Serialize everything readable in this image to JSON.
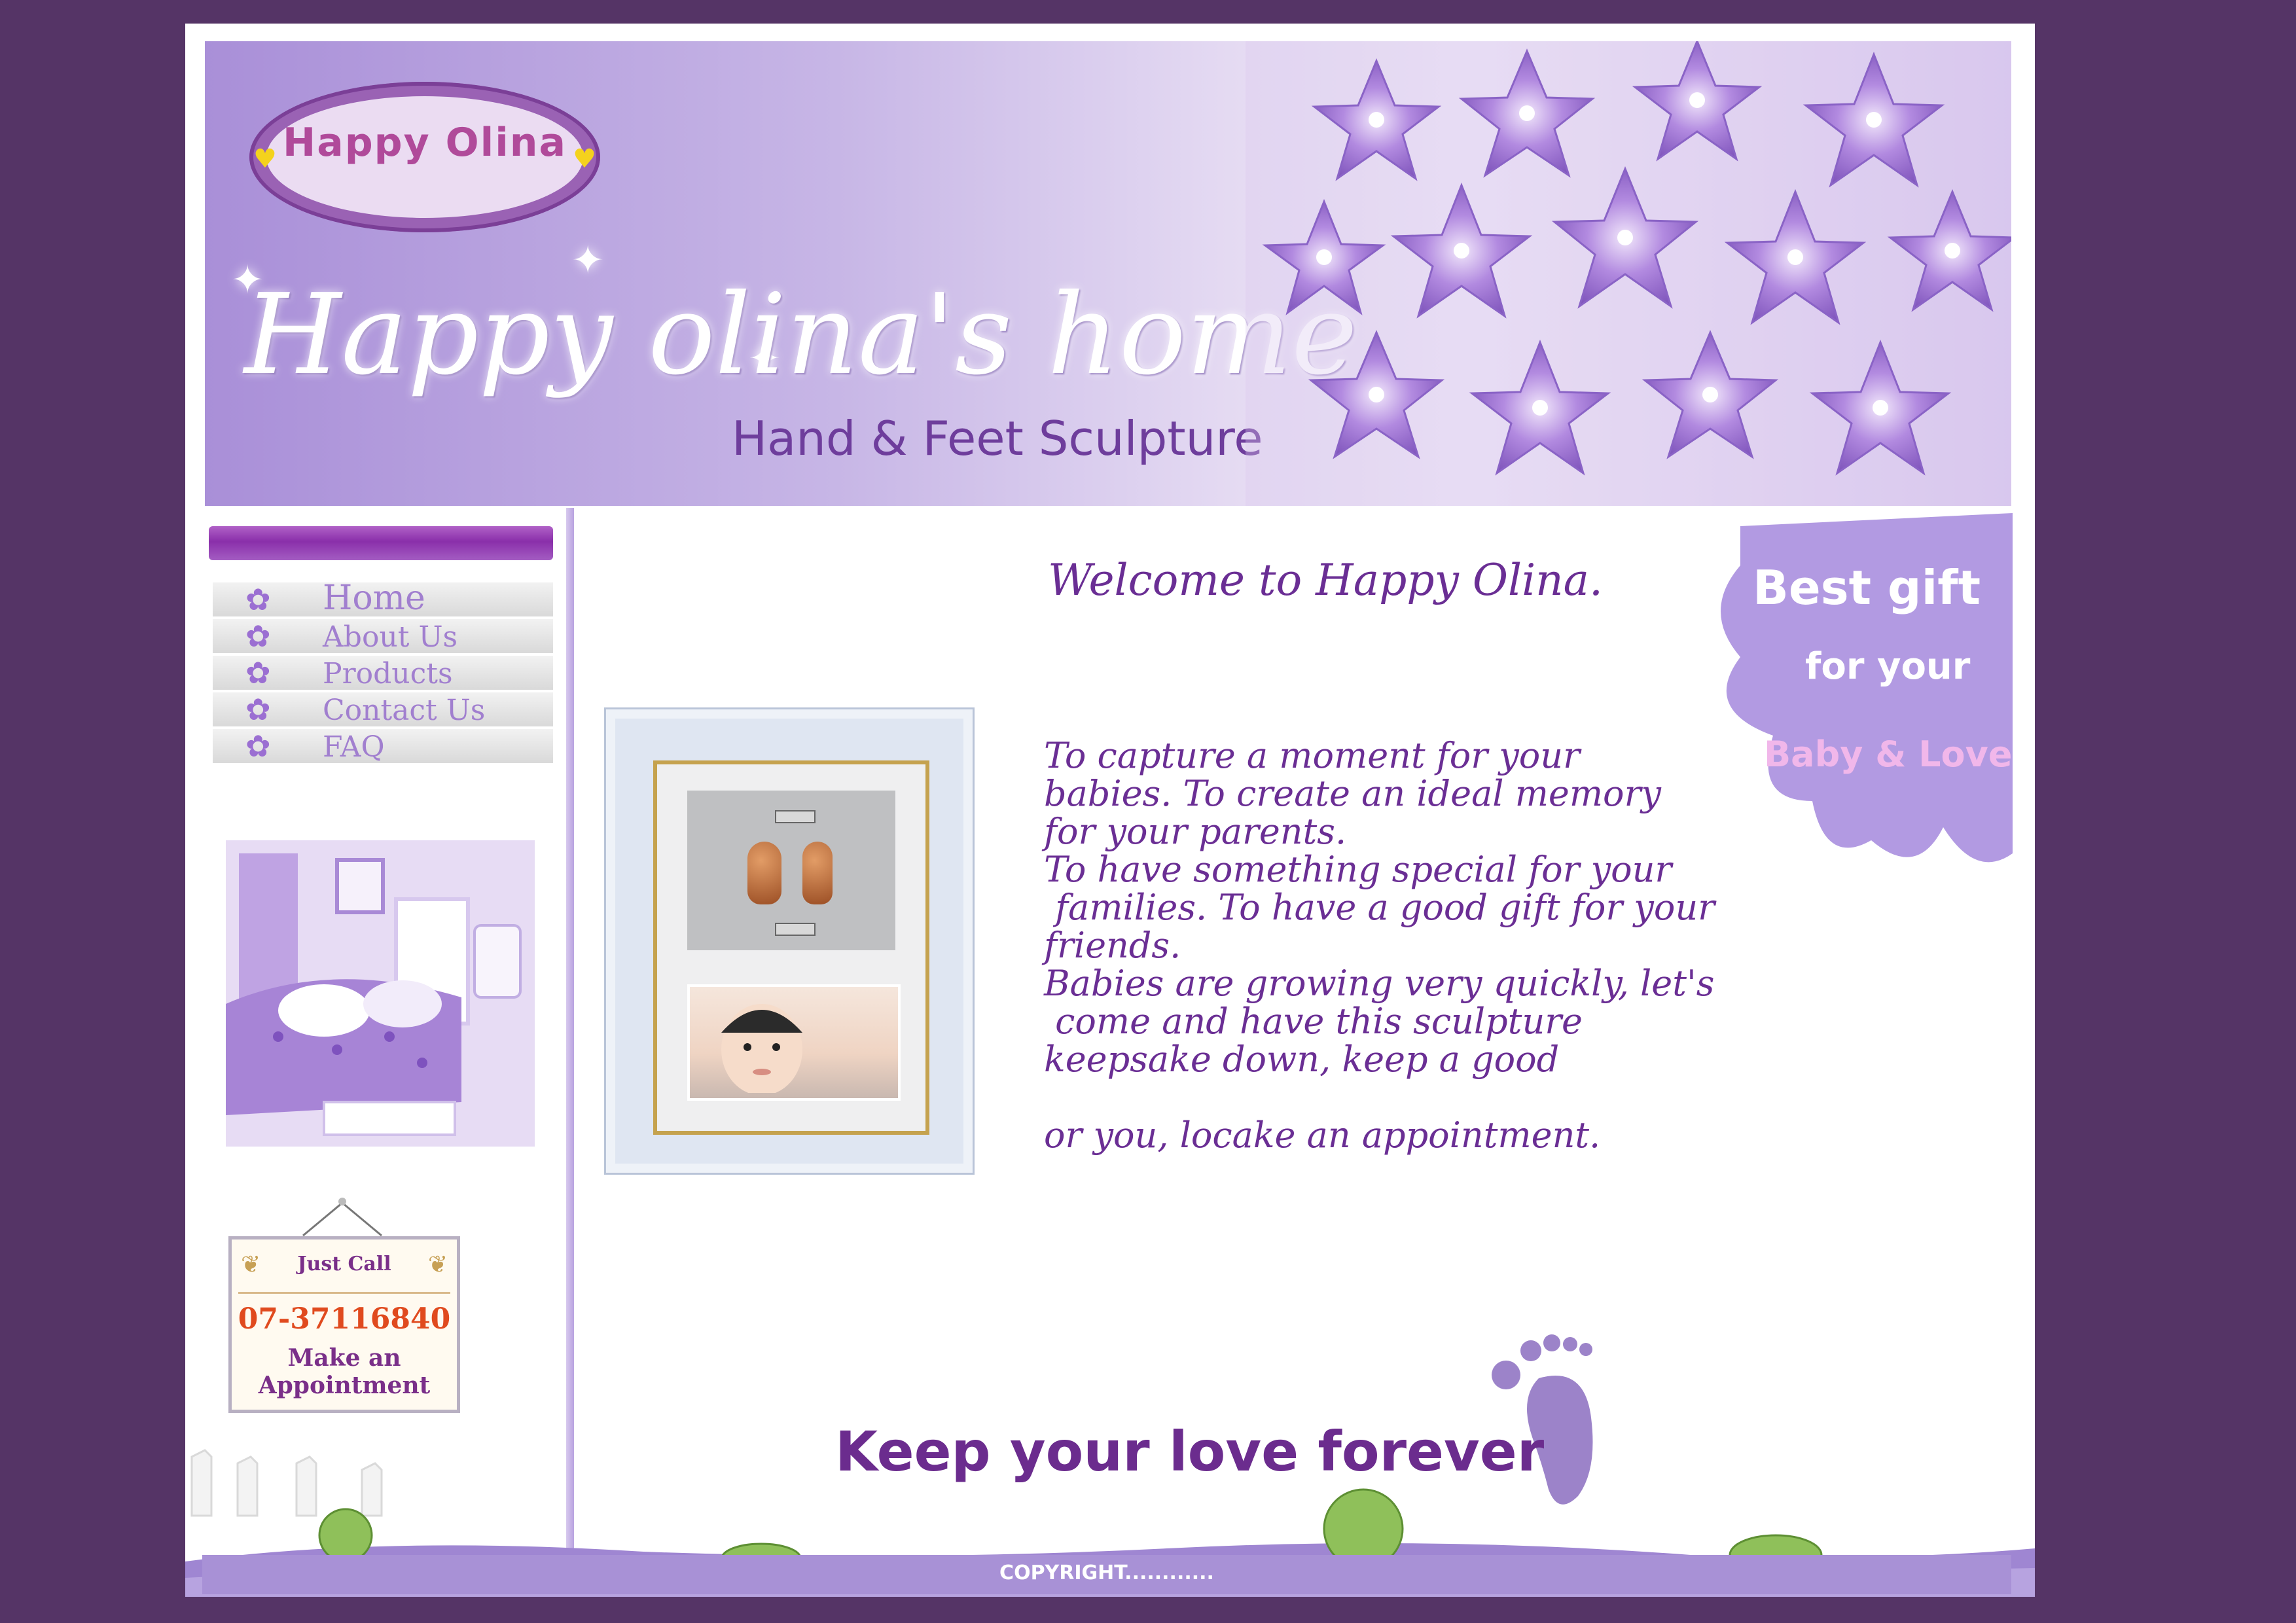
{
  "brand": {
    "logo_text": "Happy Olina",
    "colors": {
      "background": "#553466",
      "accent": "#6a2e94",
      "lavender": "#a891d6"
    }
  },
  "banner": {
    "title": "Happy olina's home",
    "subtitle": "Hand & Feet Sculpture"
  },
  "nav": {
    "items": [
      {
        "label": "Home",
        "icon": "flower-icon"
      },
      {
        "label": "About Us",
        "icon": "flower-icon"
      },
      {
        "label": "Products",
        "icon": "flower-icon"
      },
      {
        "label": "Contact Us",
        "icon": "flower-icon"
      },
      {
        "label": "FAQ",
        "icon": "flower-icon"
      }
    ]
  },
  "call_sign": {
    "title": "Just Call",
    "phone": "07-37116840",
    "cta_line1": "Make an",
    "cta_line2": "Appointment"
  },
  "main": {
    "welcome": "Welcome to Happy Olina.",
    "body": "To capture a moment for your\nbabies. To create an ideal memory\nfor your parents.\nTo have something special for your\n families. To have a good gift for your\nfriends.\nBabies are growing very quickly, let's\n come and have this sculpture\nkeepsake down, keep a good\n\nor you, locake an appointment.",
    "gift_line1": "Best gift",
    "gift_line2": "for your",
    "gift_line3": "Baby & Love",
    "tagline": "Keep your love forever"
  },
  "footer": {
    "copyright": "COPYRIGHT............"
  }
}
